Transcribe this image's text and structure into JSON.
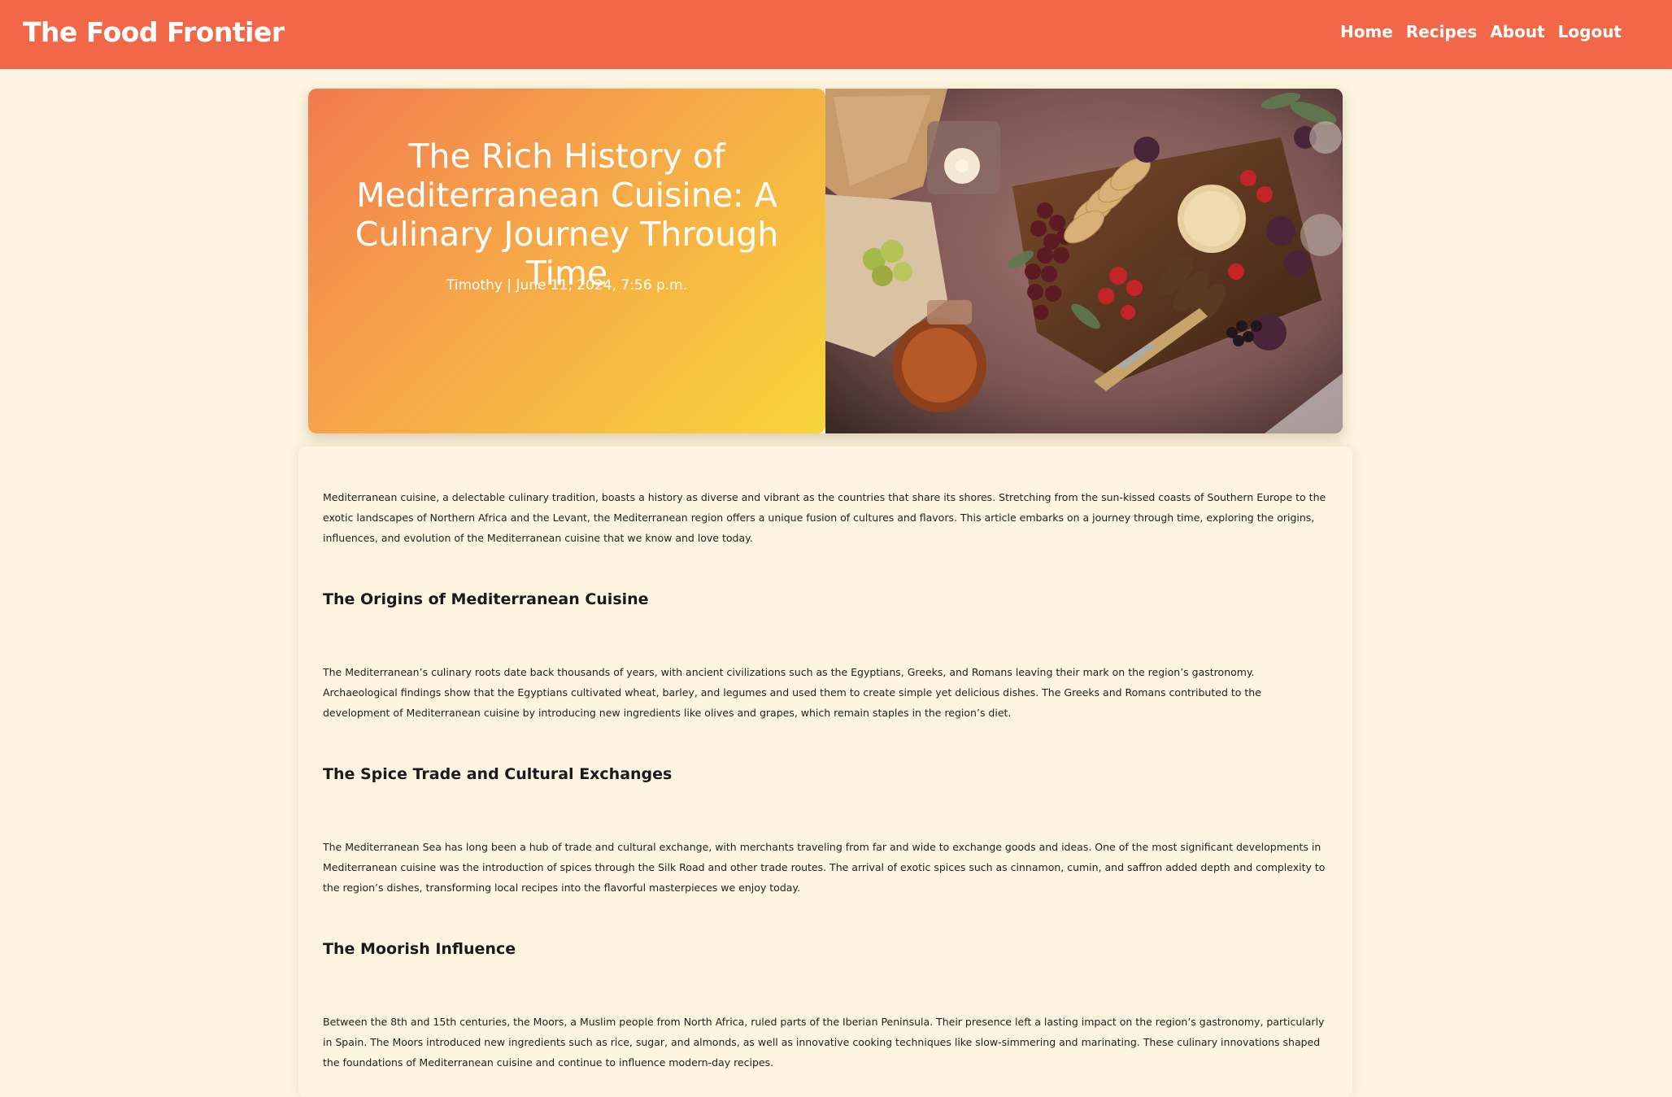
{
  "site": {
    "brand": "The Food Frontier"
  },
  "nav": {
    "items": [
      "Home",
      "Recipes",
      "About",
      "Logout"
    ]
  },
  "hero": {
    "title": "The Rich History of Mediterranean Cuisine: A Culinary Journey Through Time",
    "meta": "Timothy | June 11, 2024, 7:56 p.m.",
    "image_alt": "Mediterranean food spread with bread, grapes, figs, strawberries, cheese and olives"
  },
  "article": {
    "intro": "Mediterranean cuisine, a delectable culinary tradition, boasts a history as diverse and vibrant as the countries that share its shores. Stretching from the sun-kissed coasts of Southern Europe to the exotic landscapes of Northern Africa and the Levant, the Mediterranean region offers a unique fusion of cultures and flavors. This article embarks on a journey through time, exploring the origins, influences, and evolution of the Mediterranean cuisine that we know and love today.",
    "sections": [
      {
        "heading": "The Origins of Mediterranean Cuisine",
        "body": "The Mediterranean’s culinary roots date back thousands of years, with ancient civilizations such as the Egyptians, Greeks, and Romans leaving their mark on the region’s gastronomy. Archaeological findings show that the Egyptians cultivated wheat, barley, and legumes and used them to create simple yet delicious dishes. The Greeks and Romans contributed to the development of Mediterranean cuisine by introducing new ingredients like olives and grapes, which remain staples in the region’s diet."
      },
      {
        "heading": "The Spice Trade and Cultural Exchanges",
        "body": "The Mediterranean Sea has long been a hub of trade and cultural exchange, with merchants traveling from far and wide to exchange goods and ideas. One of the most significant developments in Mediterranean cuisine was the introduction of spices through the Silk Road and other trade routes. The arrival of exotic spices such as cinnamon, cumin, and saffron added depth and complexity to the region’s dishes, transforming local recipes into the flavorful masterpieces we enjoy today."
      },
      {
        "heading": "The Moorish Influence",
        "body": "Between the 8th and 15th centuries, the Moors, a Muslim people from North Africa, ruled parts of the Iberian Peninsula. Their presence left a lasting impact on the region’s gastronomy, particularly in Spain. The Moors introduced new ingredients such as rice, sugar, and almonds, as well as innovative cooking techniques like slow-simmering and marinating. These culinary innovations shaped the foundations of Mediterranean cuisine and continue to influence modern-day recipes."
      }
    ]
  },
  "colors": {
    "header": "#f26747",
    "page_bg": "#fdf5e1",
    "hero_gradient_start": "#f27b50",
    "hero_gradient_end": "#f8d53a"
  }
}
